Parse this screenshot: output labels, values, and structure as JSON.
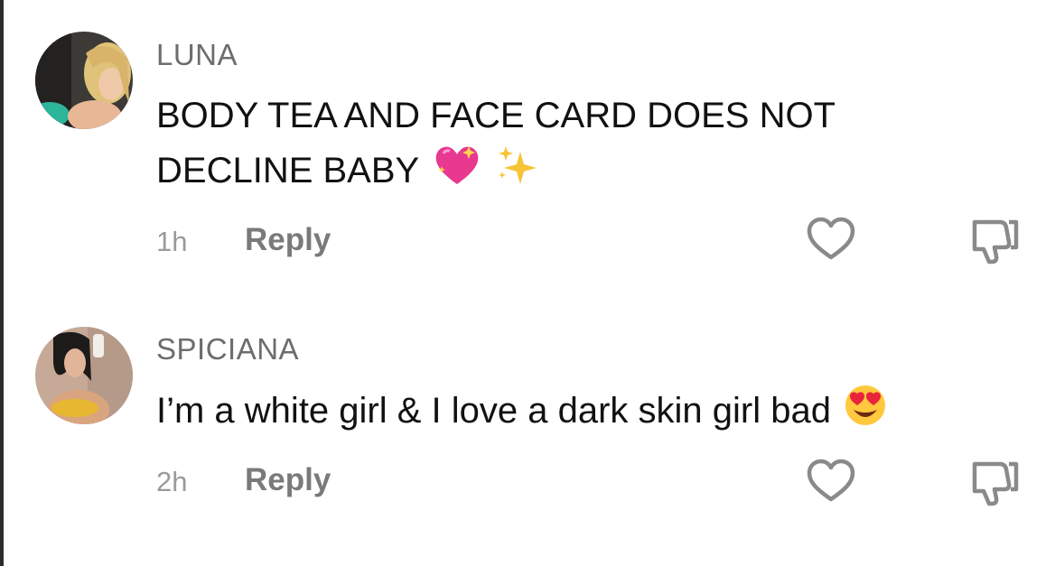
{
  "comments": [
    {
      "username": "LUNA",
      "text": "BODY TEA AND FACE CARD DOES NOT DECLINE BABY",
      "emojis": [
        "sparkling-heart",
        "sparkles"
      ],
      "time": "1h",
      "reply_label": "Reply"
    },
    {
      "username": "SPICIANA",
      "text": "I’m a white girl & I love a dark skin girl bad",
      "emojis": [
        "heart-eyes"
      ],
      "time": "2h",
      "reply_label": "Reply"
    }
  ],
  "icons": {
    "like": "heart-outline-icon",
    "dislike": "thumbs-down-outline-icon"
  },
  "colors": {
    "username": "#6d6d6d",
    "text": "#111111",
    "meta": "#9a9a9a",
    "icon_stroke": "#8a8a8a"
  }
}
